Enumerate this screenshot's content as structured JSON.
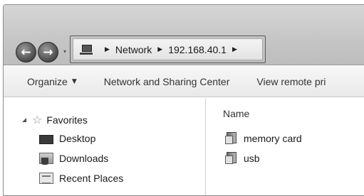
{
  "address": {
    "crumbs": [
      "Network",
      "192.168.40.1"
    ],
    "icon": "network-computer-icon"
  },
  "nav_buttons": {
    "back_glyph": "←",
    "forward_glyph": "→",
    "dropdown_glyph": "▾"
  },
  "toolbar": {
    "organize_label": "Organize",
    "network_sharing_label": "Network and Sharing Center",
    "view_remote_label": "View remote pri"
  },
  "navpane": {
    "favorites_label": "Favorites",
    "items": [
      {
        "label": "Desktop",
        "icon": "desktop-icon"
      },
      {
        "label": "Downloads",
        "icon": "downloads-icon"
      },
      {
        "label": "Recent Places",
        "icon": "recent-places-icon"
      }
    ]
  },
  "content": {
    "column_header": "Name",
    "files": [
      {
        "label": "memory card",
        "icon": "folder-icon"
      },
      {
        "label": "usb",
        "icon": "folder-icon"
      }
    ]
  }
}
